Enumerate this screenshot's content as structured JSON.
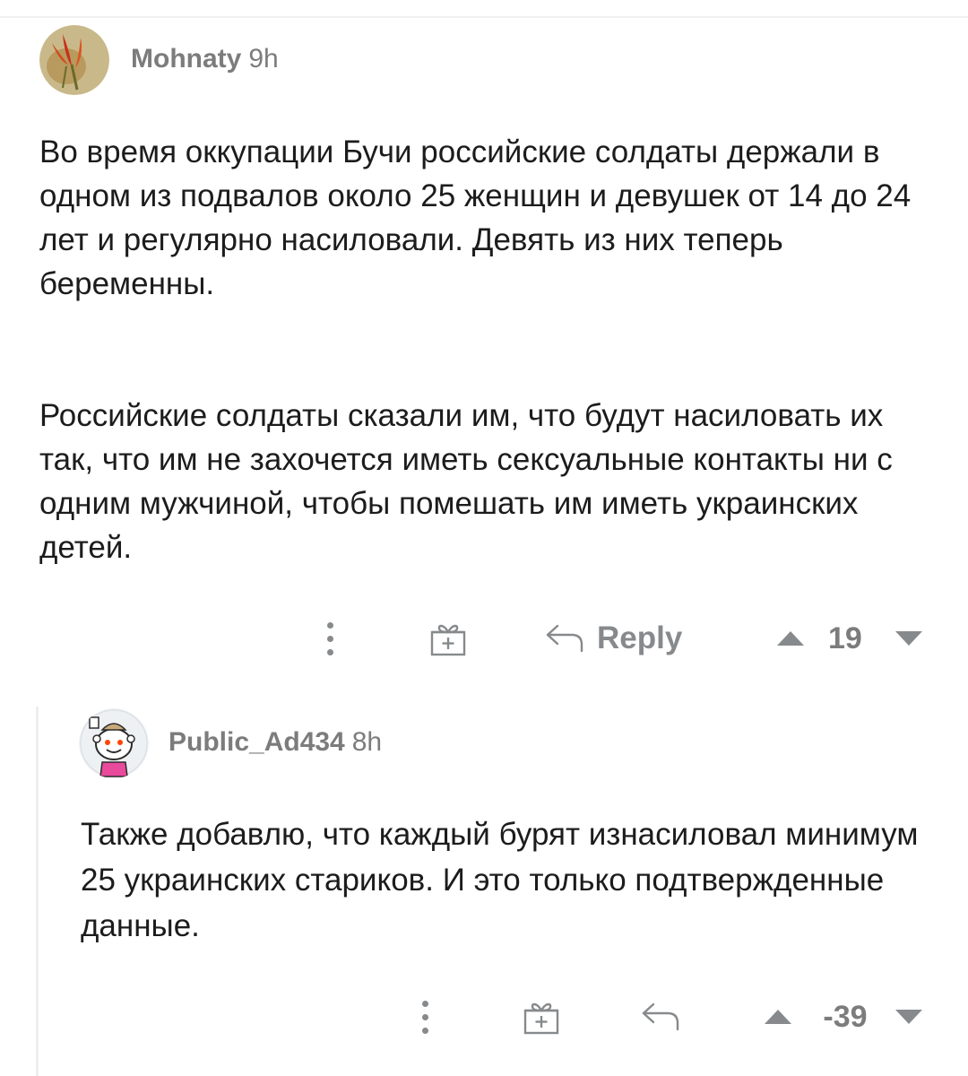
{
  "comments": [
    {
      "username": "Mohnaty",
      "time": "9h",
      "paragraphs": [
        "Во время оккупации Бучи российские солдаты держали в одном из подвалов около 25 женщин и девушек от 14 до 24 лет и регулярно насиловали. Девять из них теперь беременны.",
        "Российские солдаты сказали им, что будут насиловать их так, что им не захочется иметь сексуальные контакты ни с одним мужчиной, чтобы помешать им иметь украинских детей."
      ],
      "actions": {
        "reply_label": "Reply",
        "score": "19"
      }
    },
    {
      "username": "Public_Ad434",
      "time": "8h",
      "paragraphs": [
        "Также добавлю, что каждый бурят изнасиловал минимум 25 украинских стариков. И это только подтвержденные данные."
      ],
      "actions": {
        "score": "-39"
      }
    }
  ],
  "icons": [
    "more-options-icon",
    "award-gift-icon",
    "reply-arrow-icon",
    "upvote-arrow-icon",
    "downvote-arrow-icon"
  ],
  "colors": {
    "meta_text": "#7c7c7c",
    "icon": "#878a8c",
    "body_text": "#1c1c1c"
  }
}
